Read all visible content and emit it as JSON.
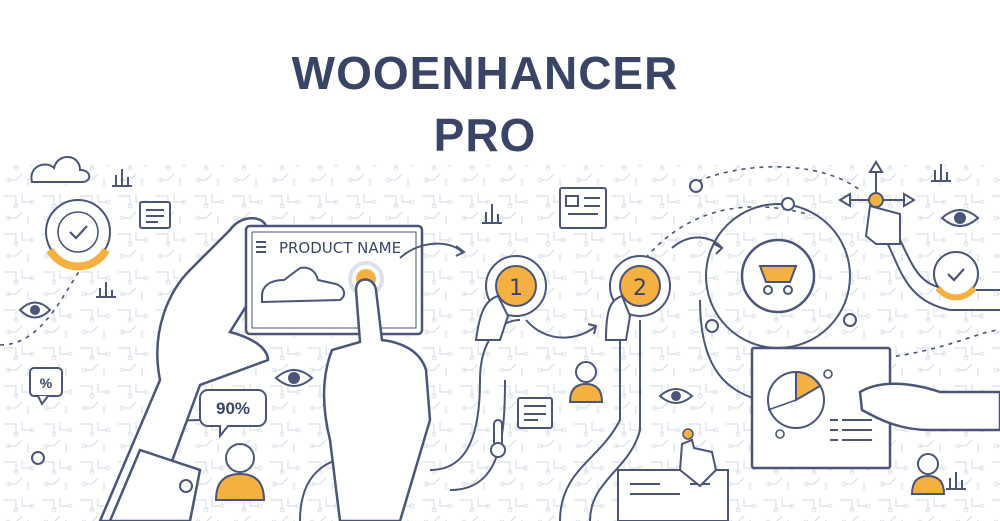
{
  "header": {
    "line1": "WOOENHANCER",
    "line2": "PRO"
  },
  "illustration": {
    "product_card_label": "PRODUCT NAME",
    "step1": "1",
    "step2": "2",
    "percent_bubble": "90%",
    "percent_icon": "%"
  },
  "colors": {
    "navy": "#3a4566",
    "accent": "#f5b042",
    "line": "#4a5578",
    "pattern": "#dde1ea"
  }
}
